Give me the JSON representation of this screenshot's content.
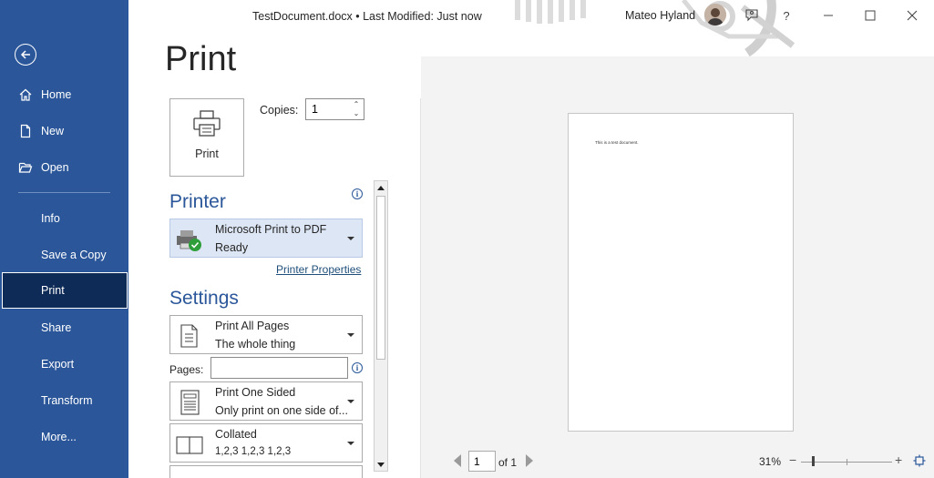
{
  "window": {
    "doc_title": "TestDocument.docx  •  Last Modified: Just now",
    "user_name": "Mateo Hyland"
  },
  "sidebar": {
    "back_icon": "arrow-left-icon",
    "items": [
      {
        "label": "Home",
        "icon": "home-icon"
      },
      {
        "label": "New",
        "icon": "new-document-icon"
      },
      {
        "label": "Open",
        "icon": "folder-open-icon"
      },
      {
        "label": "Info"
      },
      {
        "label": "Save a Copy"
      },
      {
        "label": "Print",
        "active": true
      },
      {
        "label": "Share"
      },
      {
        "label": "Export"
      },
      {
        "label": "Transform"
      },
      {
        "label": "More..."
      }
    ],
    "bg_color": "#2b579a",
    "active_color": "#0e2a57"
  },
  "page": {
    "title": "Print"
  },
  "print_button": {
    "label": "Print",
    "icon": "printer-icon"
  },
  "copies": {
    "label": "Copies:",
    "value": "1"
  },
  "printer": {
    "heading": "Printer",
    "name": "Microsoft Print to PDF",
    "status": "Ready",
    "properties_link": "Printer Properties"
  },
  "settings": {
    "heading": "Settings",
    "range": {
      "line1": "Print All Pages",
      "line2": "The whole thing"
    },
    "pages_label": "Pages:",
    "pages_value": "",
    "sides": {
      "line1": "Print One Sided",
      "line2": "Only print on one side of..."
    },
    "collation": {
      "line1": "Collated",
      "line2": "1,2,3    1,2,3    1,2,3"
    }
  },
  "preview": {
    "page_text": "This is a test document.",
    "current_page": "1",
    "of_label": "of 1",
    "zoom": "31%",
    "zoom_minus": "−",
    "zoom_plus": "+"
  },
  "title_buttons": {
    "help": "?"
  },
  "accent_color": "#2b579a"
}
